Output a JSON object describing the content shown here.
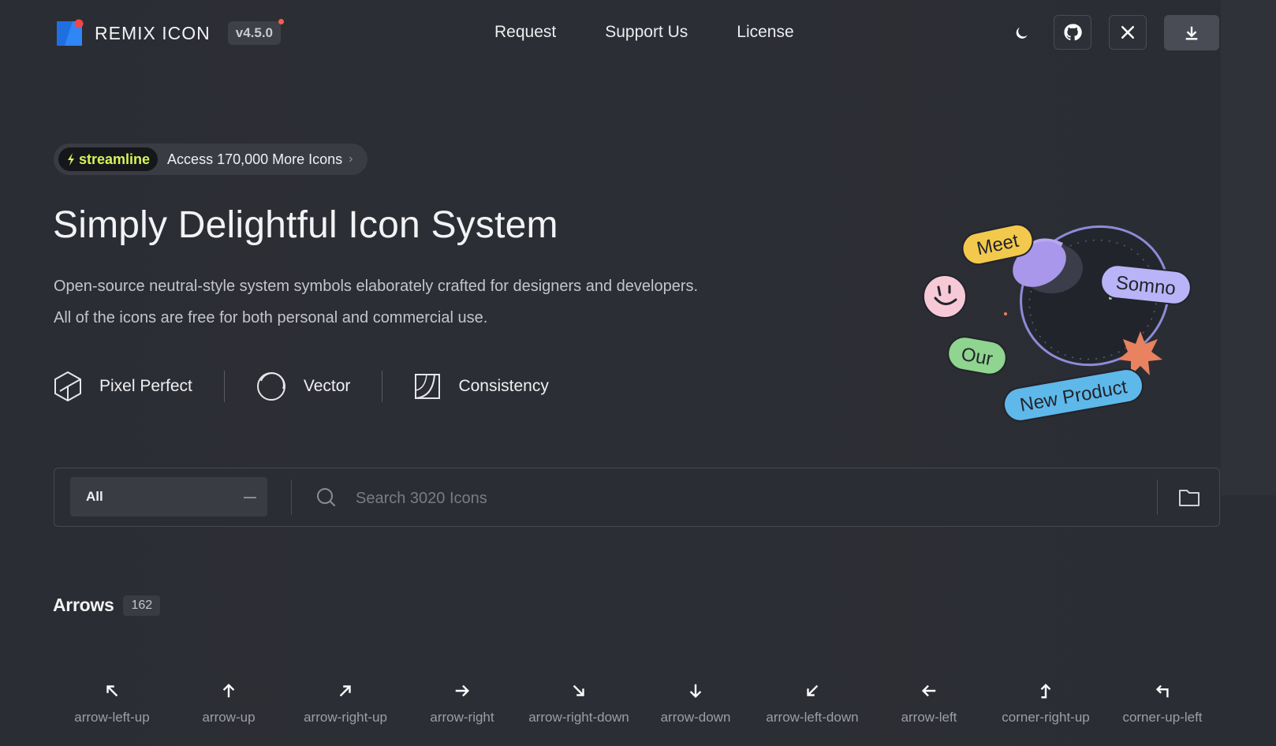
{
  "header": {
    "brand": "REMIX ICON",
    "version": "v4.5.0",
    "nav": [
      {
        "label": "Request"
      },
      {
        "label": "Support Us"
      },
      {
        "label": "License"
      }
    ],
    "icons": {
      "theme": "moon-icon",
      "github": "github-icon",
      "x": "x-twitter-icon",
      "download": "download-icon"
    }
  },
  "promo": {
    "brand": "streamline",
    "text": "Access 170,000 More Icons",
    "chevron": "›"
  },
  "hero": {
    "title": "Simply Delightful Icon System",
    "subtitle_line1": "Open-source neutral-style system symbols elaborately crafted for designers and developers.",
    "subtitle_line2": "All of the icons are free for both personal and commercial use.",
    "features": [
      {
        "label": "Pixel Perfect",
        "icon": "cube-icon"
      },
      {
        "label": "Vector",
        "icon": "vector-circle-icon"
      },
      {
        "label": "Consistency",
        "icon": "consistency-square-icon"
      }
    ]
  },
  "illustration": {
    "tags": [
      "Meet",
      "Somno",
      "Our",
      "New Product"
    ],
    "colors": {
      "meet": "#f2c94c",
      "somno": "#b9b4f7",
      "our": "#8fd48f",
      "new_product": "#5fb8ea",
      "star": "#e8825f",
      "face": "#f7c9d7"
    }
  },
  "search": {
    "category": "All",
    "placeholder": "Search 3020 Icons"
  },
  "section": {
    "name": "Arrows",
    "count": "162",
    "icons": [
      {
        "label": "arrow-left-up",
        "glyph": "↖"
      },
      {
        "label": "arrow-up",
        "glyph": "↑"
      },
      {
        "label": "arrow-right-up",
        "glyph": "↗"
      },
      {
        "label": "arrow-right",
        "glyph": "→"
      },
      {
        "label": "arrow-right-down",
        "glyph": "↘"
      },
      {
        "label": "arrow-down",
        "glyph": "↓"
      },
      {
        "label": "arrow-left-down",
        "glyph": "↙"
      },
      {
        "label": "arrow-left",
        "glyph": "←"
      },
      {
        "label": "corner-right-up",
        "glyph": "⬏"
      },
      {
        "label": "corner-up-left",
        "glyph": "↰"
      }
    ]
  }
}
